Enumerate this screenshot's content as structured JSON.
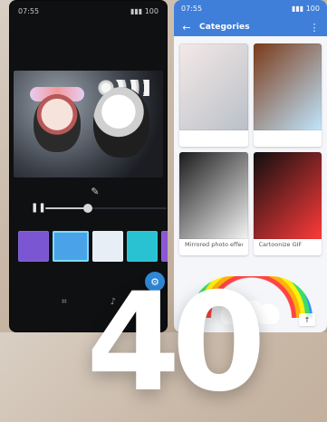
{
  "left_phone": {
    "status": {
      "left": "07:55",
      "right": "▮▮▮ 100"
    },
    "video": {},
    "timeline": {
      "progress": 0.35
    },
    "thumbnails": [
      {
        "label": "",
        "color": "#7b56d2"
      },
      {
        "label": "",
        "color": "#4aa3e8"
      },
      {
        "label": "",
        "color": "#e8eef5"
      },
      {
        "label": "",
        "color": "#28c2d3"
      },
      {
        "label": "",
        "color": "#8b56d6"
      }
    ],
    "fab": {
      "icon": "settings-icon"
    },
    "bottom_bar": {
      "left_icon": "crop-icon",
      "right_icon": "music-icon"
    }
  },
  "right_phone": {
    "status": {
      "left": "07:55",
      "right": "▮▮▮ 100"
    },
    "toolbar": {
      "title": "Categories"
    },
    "cards": [
      {
        "label": "",
        "theme": [
          "#f4e9e7",
          "#b9c0c8"
        ]
      },
      {
        "label": "",
        "theme": [
          "#7a3a18",
          "#c0e6ff"
        ]
      },
      {
        "label": "Mirrored photo effect",
        "theme": [
          "#1b1b1b",
          "#f4f4f4"
        ]
      },
      {
        "label": "Cartoonize GIF",
        "theme": [
          "#0f0f10",
          "#ff3a3a"
        ]
      }
    ],
    "bottom_banner": {
      "badge": "↑"
    }
  },
  "overlay": {
    "number": "40"
  }
}
